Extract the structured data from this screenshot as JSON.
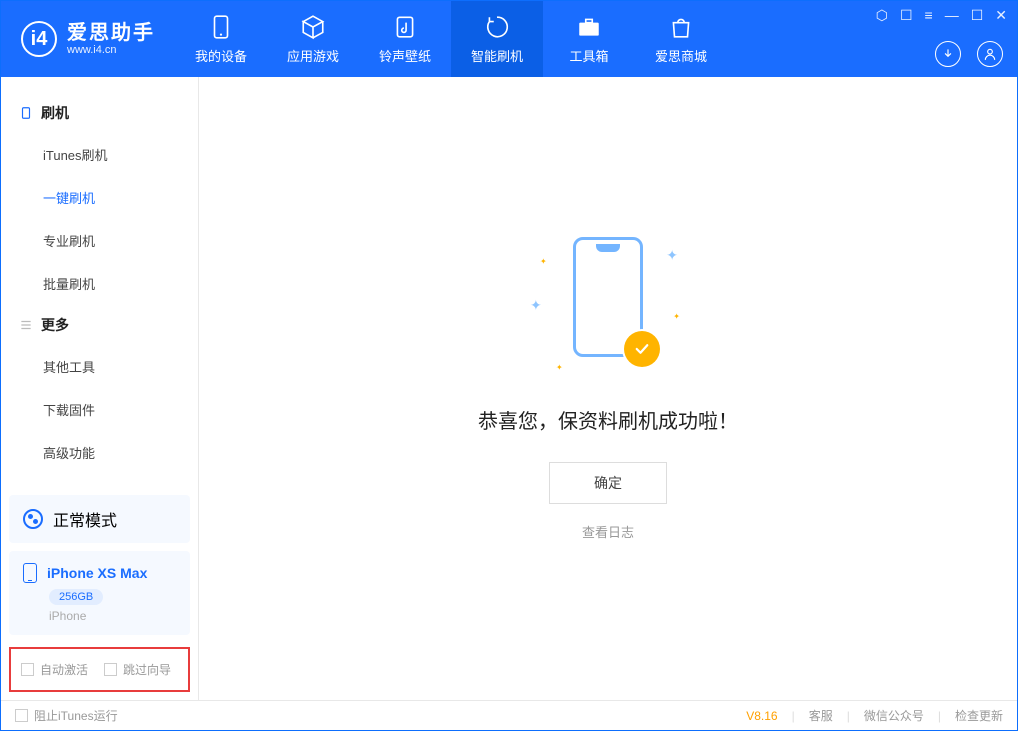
{
  "app": {
    "name": "爱思助手",
    "url": "www.i4.cn"
  },
  "nav": {
    "tabs": [
      {
        "label": "我的设备"
      },
      {
        "label": "应用游戏"
      },
      {
        "label": "铃声壁纸"
      },
      {
        "label": "智能刷机"
      },
      {
        "label": "工具箱"
      },
      {
        "label": "爱思商城"
      }
    ]
  },
  "sidebar": {
    "section1": {
      "title": "刷机",
      "items": [
        "iTunes刷机",
        "一键刷机",
        "专业刷机",
        "批量刷机"
      ]
    },
    "section2": {
      "title": "更多",
      "items": [
        "其他工具",
        "下载固件",
        "高级功能"
      ]
    },
    "mode": "正常模式",
    "device": {
      "name": "iPhone XS Max",
      "storage": "256GB",
      "type": "iPhone"
    },
    "checkboxes": {
      "auto_activate": "自动激活",
      "skip_guide": "跳过向导"
    }
  },
  "main": {
    "success_message": "恭喜您，保资料刷机成功啦！",
    "confirm": "确定",
    "view_log": "查看日志"
  },
  "bottom": {
    "block_itunes": "阻止iTunes运行",
    "version": "V8.16",
    "support": "客服",
    "wechat": "微信公众号",
    "update": "检查更新"
  }
}
